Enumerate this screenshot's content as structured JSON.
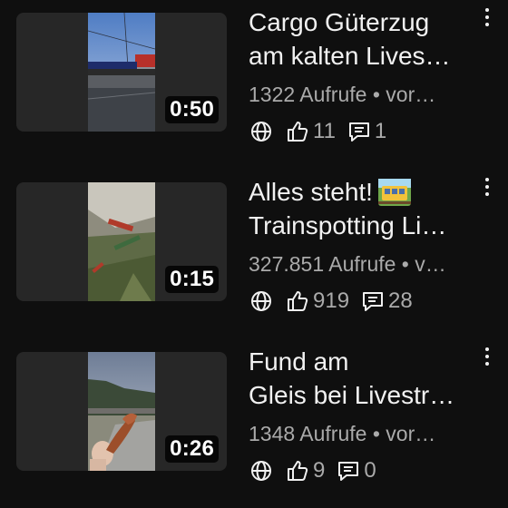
{
  "videos": [
    {
      "title_line1": "Cargo Güterzug",
      "title_line2": "am kalten Lives…",
      "meta": "1322 Aufrufe • vor…",
      "duration": "0:50",
      "likes": "11",
      "comments": "1"
    },
    {
      "title_line1": "Alles steht!",
      "title_line2": "Trainspotting Li…",
      "meta": "327.851 Aufrufe • v…",
      "duration": "0:15",
      "likes": "919",
      "comments": "28"
    },
    {
      "title_line1": "Fund am",
      "title_line2": "Gleis bei Livestr…",
      "meta": "1348 Aufrufe • vor…",
      "duration": "0:26",
      "likes": "9",
      "comments": "0"
    }
  ],
  "icons": {
    "visibility": "globe-icon",
    "likes": "thumbs-up-icon",
    "comments": "comment-icon",
    "menu": "more-vert-icon",
    "emoji": "mountain-railway-emoji"
  },
  "colors": {
    "background": "#0f0f0f",
    "primary_text": "#f1f1f1",
    "secondary_text": "#aaaaaa",
    "thumb_frame": "#272727"
  }
}
